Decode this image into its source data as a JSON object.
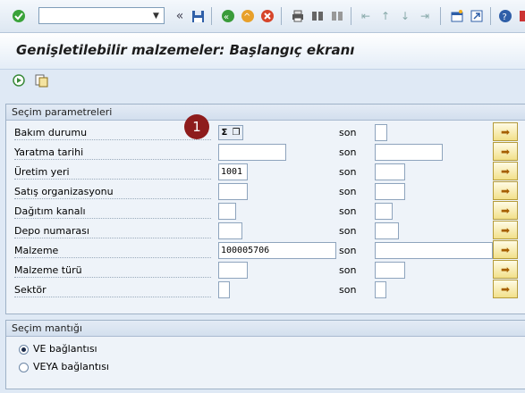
{
  "toolbar": {
    "command_value": "",
    "icons": [
      "enter-icon",
      "back-icon",
      "exit-icon",
      "cancel-icon",
      "print-icon",
      "find-icon",
      "find-next-icon",
      "first-page-icon",
      "previous-page-icon",
      "next-page-icon",
      "last-page-icon",
      "new-session-icon",
      "shortcut-icon",
      "help-icon"
    ]
  },
  "title": "Genişletilebilir malzemeler: Başlangıç ekranı",
  "selection_group": {
    "header": "Seçim parametreleri",
    "son_label": "son",
    "badge": "1",
    "fields": [
      {
        "label": "Bakım durumu",
        "from": "",
        "to": ""
      },
      {
        "label": "Yaratma tarihi",
        "from": "",
        "to": ""
      },
      {
        "label": "Üretim yeri",
        "from": "1001",
        "to": ""
      },
      {
        "label": "Satış organizasyonu",
        "from": "",
        "to": ""
      },
      {
        "label": "Dağıtım kanalı",
        "from": "",
        "to": ""
      },
      {
        "label": "Depo numarası",
        "from": "",
        "to": ""
      },
      {
        "label": "Malzeme",
        "from": "100005706",
        "to": ""
      },
      {
        "label": "Malzeme türü",
        "from": "",
        "to": ""
      },
      {
        "label": "Sektör",
        "from": "",
        "to": ""
      }
    ]
  },
  "logic_group": {
    "header": "Seçim mantığı",
    "options": [
      {
        "label": "VE bağlantısı",
        "selected": true
      },
      {
        "label": "VEYA bağlantısı",
        "selected": false
      }
    ]
  }
}
